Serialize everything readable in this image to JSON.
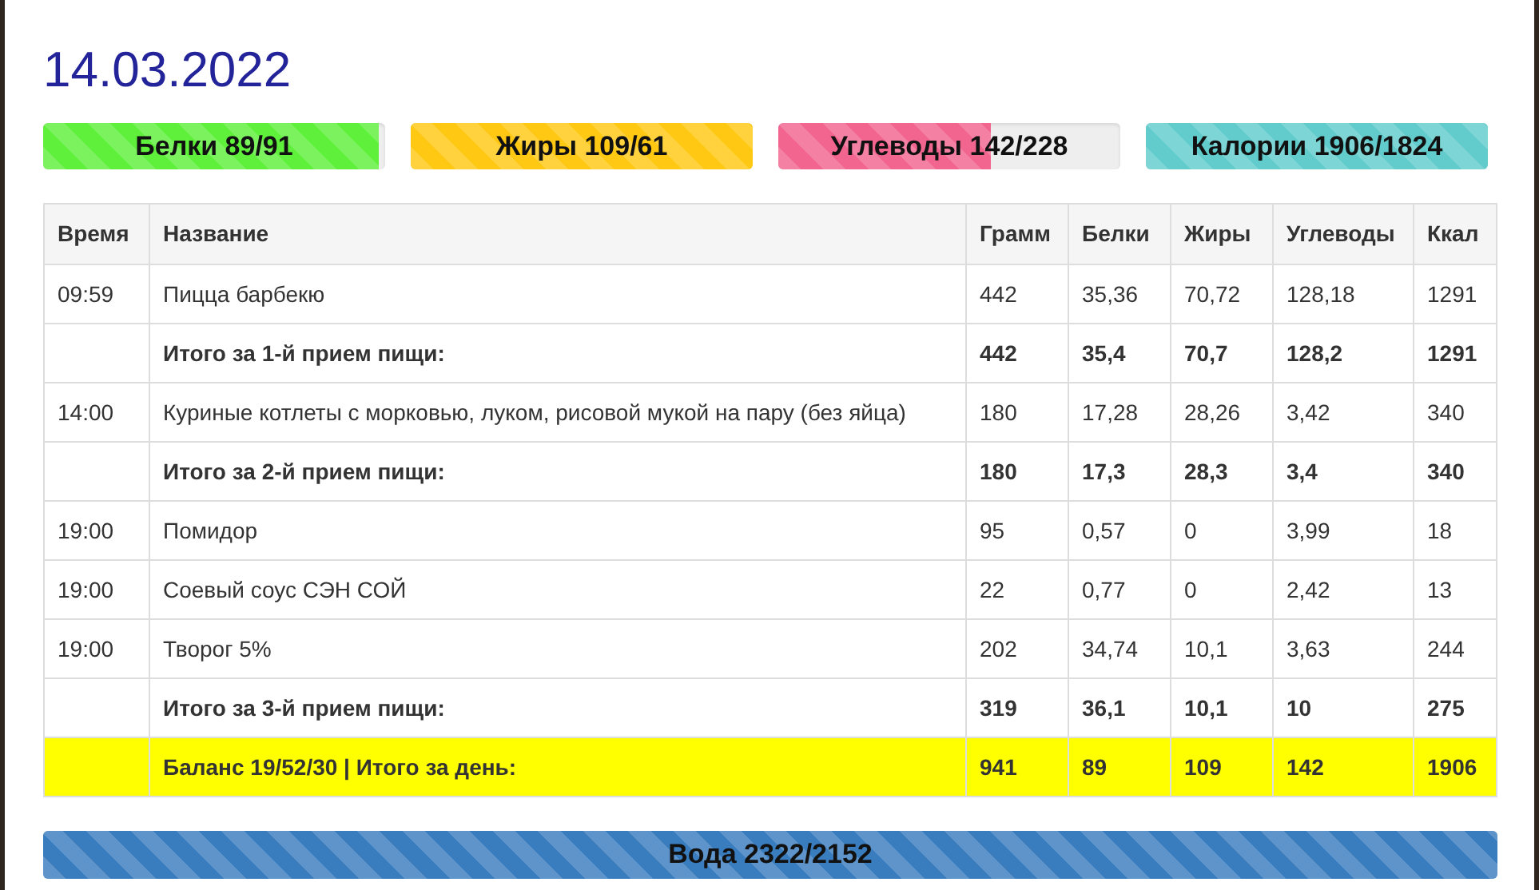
{
  "date": "14.03.2022",
  "bars": [
    {
      "label": "Белки 89/91",
      "level": 0.98,
      "color": "#5ef03a"
    },
    {
      "label": "Жиры 109/61",
      "level": 1,
      "color": "#ffc813"
    },
    {
      "label": "Углеводы 142/228",
      "level": 0.62,
      "color": "#f2658f"
    },
    {
      "label": "Калории 1906/1824",
      "level": 1,
      "color": "#62cccc"
    }
  ],
  "table": {
    "columns": [
      "Время",
      "Название",
      "Грамм",
      "Белки",
      "Жиры",
      "Углеводы",
      "Ккал"
    ],
    "rows": [
      {
        "kind": "item",
        "cells": [
          "09:59",
          "Пицца барбекю",
          "442",
          "35,36",
          "70,72",
          "128,18",
          "1291"
        ]
      },
      {
        "kind": "subtotal",
        "cells": [
          "",
          "Итого за 1-й прием пищи:",
          "442",
          "35,4",
          "70,7",
          "128,2",
          "1291"
        ]
      },
      {
        "kind": "item",
        "cells": [
          "14:00",
          "Куриные котлеты с морковью, луком, рисовой мукой на пару (без яйца)",
          "180",
          "17,28",
          "28,26",
          "3,42",
          "340"
        ]
      },
      {
        "kind": "subtotal",
        "cells": [
          "",
          "Итого за 2-й прием пищи:",
          "180",
          "17,3",
          "28,3",
          "3,4",
          "340"
        ]
      },
      {
        "kind": "item",
        "cells": [
          "19:00",
          "Помидор",
          "95",
          "0,57",
          "0",
          "3,99",
          "18"
        ]
      },
      {
        "kind": "item",
        "cells": [
          "19:00",
          "Соевый соус СЭН СОЙ",
          "22",
          "0,77",
          "0",
          "2,42",
          "13"
        ]
      },
      {
        "kind": "item",
        "cells": [
          "19:00",
          "Творог 5%",
          "202",
          "34,74",
          "10,1",
          "3,63",
          "244"
        ]
      },
      {
        "kind": "subtotal",
        "cells": [
          "",
          "Итого за 3-й прием пищи:",
          "319",
          "36,1",
          "10,1",
          "10",
          "275"
        ]
      },
      {
        "kind": "total",
        "cells": [
          "",
          "Баланс 19/52/30 | Итого за день:",
          "941",
          "89",
          "109",
          "142",
          "1906"
        ]
      }
    ]
  },
  "water": {
    "label": "Вода 2322/2152",
    "level": 1,
    "color": "#3a7dbf"
  }
}
